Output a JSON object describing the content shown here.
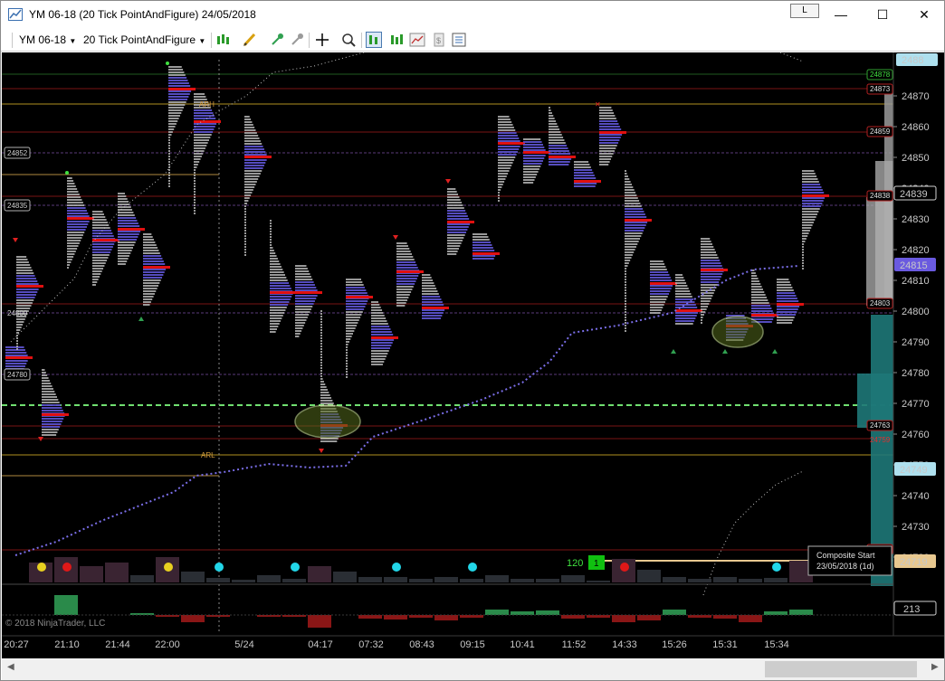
{
  "window": {
    "title": "YM 06-18 (20 Tick PointAndFigure)  24/05/2018",
    "link_button": "L",
    "minimize": "—",
    "maximize": "☐",
    "close": "✕"
  },
  "toolbar": {
    "instrument": "YM 06-18",
    "bar_type": "20 Tick PointAndFigure"
  },
  "colors": {
    "background": "#000000",
    "profile_buy": "#5a50c8",
    "profile_neutral": "#b4b4b4",
    "poc": "#e01010",
    "vwap": "#7a6ee8",
    "highlight": "#c8e890",
    "cyan": "#22d6e8",
    "yellow": "#e8d020",
    "red": "#e01818"
  },
  "price_axis": {
    "ticks": [
      "24870",
      "24860",
      "24850",
      "24840",
      "24830",
      "24820",
      "24810",
      "24800",
      "24790",
      "24780",
      "24770",
      "24760",
      "24750",
      "24740",
      "24730",
      "24720"
    ],
    "top_partial": "2488",
    "markers": {
      "m24878": "24878",
      "m24873": "24873",
      "m24859": "24859",
      "m24839": "24839",
      "m24838": "24838",
      "m24815": "24815",
      "m24803": "24803",
      "m24763": "24763",
      "m24759": "24759",
      "m24749": "24749",
      "m24723": "24723",
      "m24719": "24719"
    },
    "left_labels": {
      "l24852": "24852",
      "l24835": "24835",
      "l24800": "24800",
      "l24780": "24780"
    }
  },
  "annotations": {
    "arh": "ARH",
    "arl": "ARL",
    "composite_title": "Composite Start",
    "composite_date": "23/05/2018 (1d)",
    "box_value": "1",
    "box_label": "120"
  },
  "lower_panel": {
    "value": "213",
    "copyright": "© 2018 NinjaTrader, LLC"
  },
  "time_axis": [
    "20:27",
    "21:10",
    "21:44",
    "22:00",
    "5/24",
    "04:17",
    "07:32",
    "08:43",
    "09:15",
    "10:41",
    "11:52",
    "14:33",
    "15:26",
    "15:31",
    "15:34"
  ]
}
